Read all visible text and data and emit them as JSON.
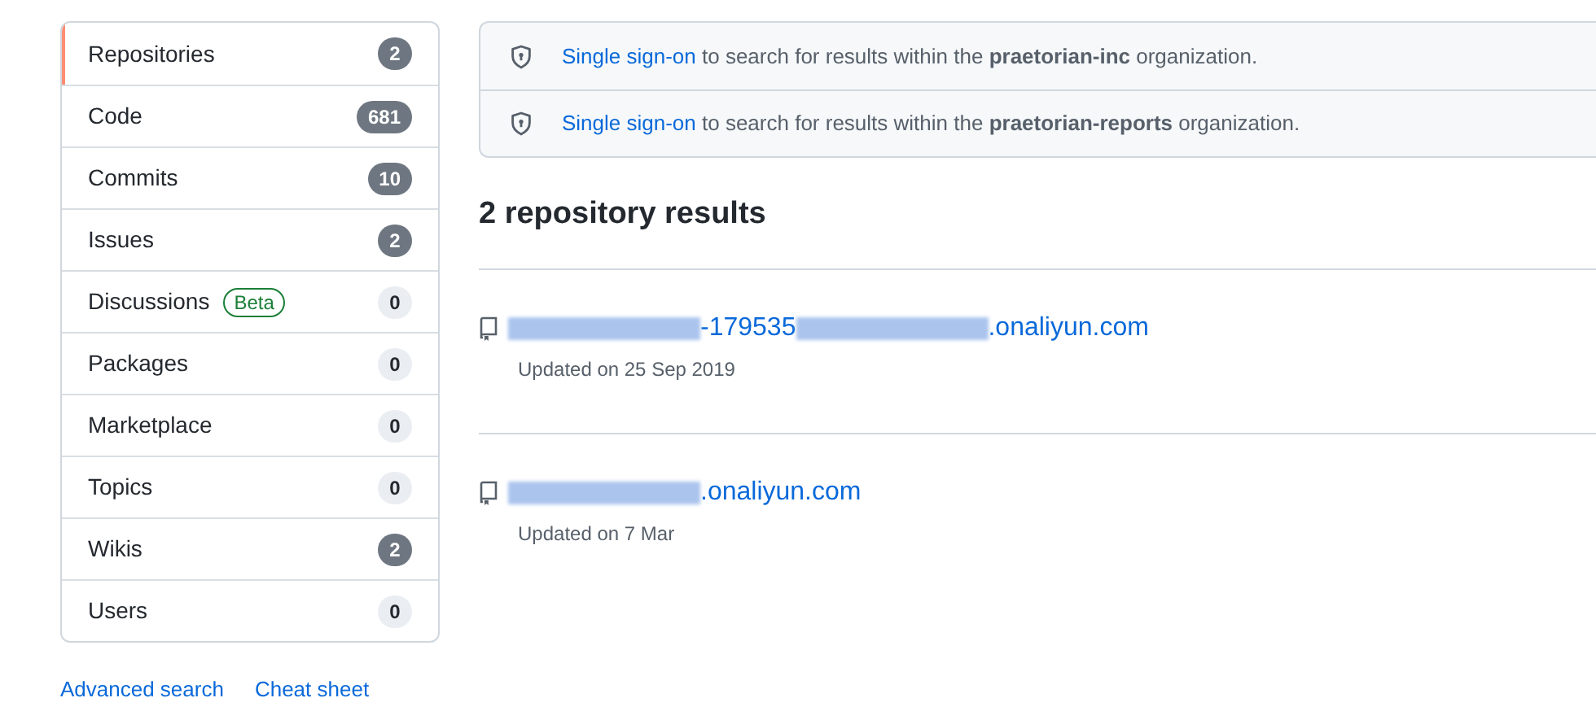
{
  "sidebar": {
    "items": [
      {
        "label": "Repositories",
        "count": "2",
        "highlighted": true,
        "selected": true
      },
      {
        "label": "Code",
        "count": "681",
        "highlighted": true,
        "selected": false
      },
      {
        "label": "Commits",
        "count": "10",
        "highlighted": true,
        "selected": false
      },
      {
        "label": "Issues",
        "count": "2",
        "highlighted": true,
        "selected": false
      },
      {
        "label": "Discussions",
        "badge": "Beta",
        "count": "0",
        "highlighted": false,
        "selected": false
      },
      {
        "label": "Packages",
        "count": "0",
        "highlighted": false,
        "selected": false
      },
      {
        "label": "Marketplace",
        "count": "0",
        "highlighted": false,
        "selected": false
      },
      {
        "label": "Topics",
        "count": "0",
        "highlighted": false,
        "selected": false
      },
      {
        "label": "Wikis",
        "count": "2",
        "highlighted": true,
        "selected": false
      },
      {
        "label": "Users",
        "count": "0",
        "highlighted": false,
        "selected": false
      }
    ],
    "links": [
      "Advanced search",
      "Cheat sheet"
    ]
  },
  "sso_notices": [
    {
      "link": "Single sign-on",
      "rest": "to search for results within the **praetorian-inc** organization."
    },
    {
      "link": "Single sign-on",
      "rest": "to search for results within the **praetorian-reports** organization."
    }
  ],
  "results_heading": "2 repository results",
  "results": [
    {
      "title_parts": [
        {
          "kind": "redacted"
        },
        {
          "kind": "text",
          "text": "-179535"
        },
        {
          "kind": "redacted"
        },
        {
          "kind": "text",
          "text": ".onaliyun.com"
        }
      ],
      "updated": "Updated on 25 Sep 2019"
    },
    {
      "title_parts": [
        {
          "kind": "redacted"
        },
        {
          "kind": "text",
          "text": ".onaliyun.com"
        }
      ],
      "updated": "Updated on 7 Mar"
    }
  ]
}
